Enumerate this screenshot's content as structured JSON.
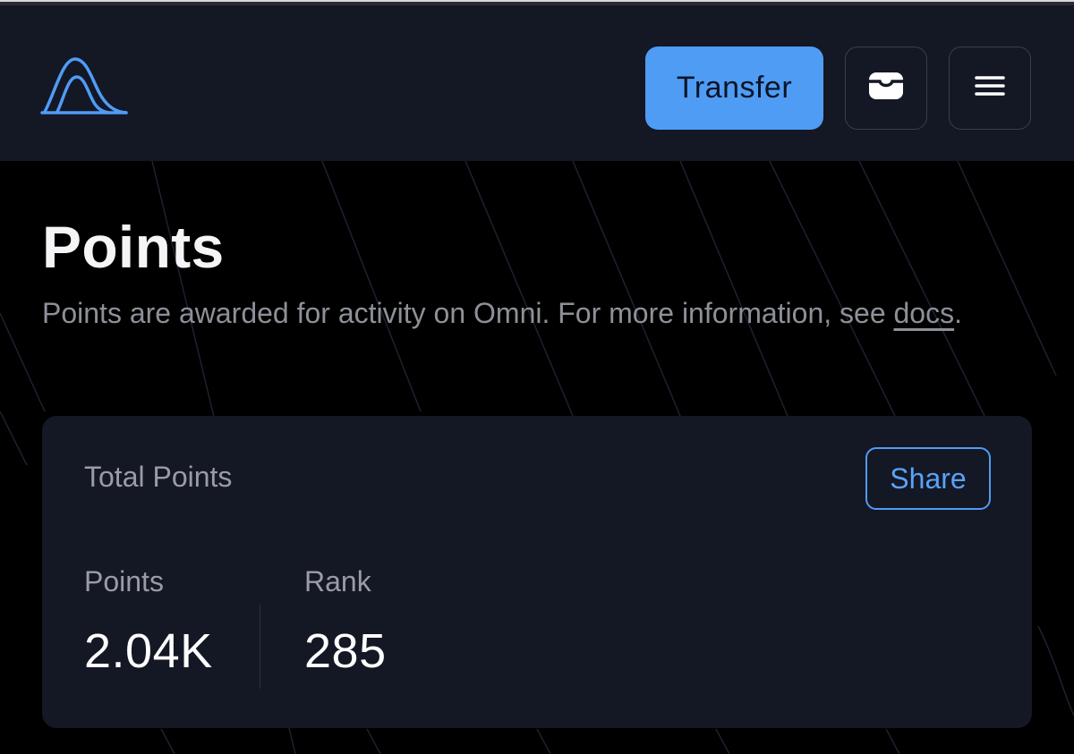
{
  "header": {
    "logo_icon": "omni-logo-icon",
    "transfer_label": "Transfer",
    "wallet_icon": "wallet-icon",
    "menu_icon": "menu-icon"
  },
  "page": {
    "title": "Points",
    "description": "Points are awarded for activity on Omni. For more information, see",
    "docs_link": "docs",
    "description_end": "."
  },
  "card": {
    "title": "Total Points",
    "share_label": "Share",
    "stats": [
      {
        "label": "Points",
        "value": "2.04K"
      },
      {
        "label": "Rank",
        "value": "285"
      }
    ]
  },
  "colors": {
    "accent": "#4f9cf5",
    "header_bg": "#141724",
    "page_bg": "#000000",
    "muted_text": "#8e9099"
  }
}
